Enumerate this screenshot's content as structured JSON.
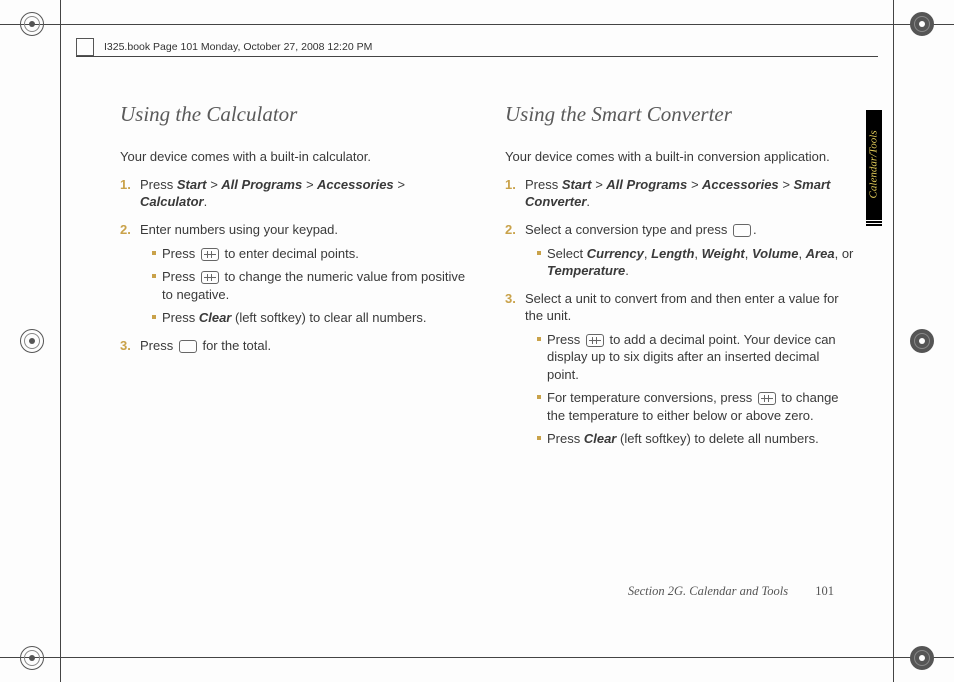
{
  "bookline": "I325.book  Page 101  Monday, October 27, 2008  12:20 PM",
  "tab_label": "Calendar/Tools",
  "footer_section": "Section 2G. Calendar and Tools",
  "footer_page": "101",
  "left": {
    "heading": "Using the Calculator",
    "intro": "Your device comes with a built-in calculator.",
    "step1_num": "1.",
    "step1_a": "Press ",
    "step1_b": "Start",
    "step1_c": " > ",
    "step1_d": "All Programs",
    "step1_e": " > ",
    "step1_f": "Accessories",
    "step1_g": " > ",
    "step1_h": "Calculator",
    "step1_i": ".",
    "step2_num": "2.",
    "step2_text": "Enter numbers using your keypad.",
    "step2_s1_a": "Press ",
    "step2_s1_b": " to enter decimal points.",
    "step2_s2_a": "Press ",
    "step2_s2_b": " to change the numeric value from positive to negative.",
    "step2_s3_a": "Press ",
    "step2_s3_b": "Clear",
    "step2_s3_c": " (left softkey) to clear all numbers.",
    "step3_num": "3.",
    "step3_a": "Press ",
    "step3_b": " for the total."
  },
  "right": {
    "heading": "Using the Smart Converter",
    "intro": "Your device comes with a built-in conversion application.",
    "step1_num": "1.",
    "step1_a": "Press ",
    "step1_b": "Start",
    "step1_c": " > ",
    "step1_d": "All Programs",
    "step1_e": " > ",
    "step1_f": "Accessories",
    "step1_g": " > ",
    "step1_h": "Smart Converter",
    "step1_i": ".",
    "step2_num": "2.",
    "step2_a": "Select a conversion type and press ",
    "step2_b": ".",
    "step2_s1_a": "Select ",
    "step2_s1_b": "Currency",
    "step2_s1_c": ", ",
    "step2_s1_d": "Length",
    "step2_s1_e": ", ",
    "step2_s1_f": "Weight",
    "step2_s1_g": ", ",
    "step2_s1_h": "Volume",
    "step2_s1_i": ", ",
    "step2_s1_j": "Area",
    "step2_s1_k": ", or ",
    "step2_s1_l": "Temperature",
    "step2_s1_m": ".",
    "step3_num": "3.",
    "step3_text": "Select a unit to convert from and then enter a value for the unit.",
    "step3_s1_a": "Press ",
    "step3_s1_b": " to add a decimal point. Your device can display up to six digits after an inserted decimal point.",
    "step3_s2_a": "For temperature conversions, press ",
    "step3_s2_b": " to change the temperature to either below or above zero.",
    "step3_s3_a": "Press ",
    "step3_s3_b": "Clear",
    "step3_s3_c": " (left softkey) to delete all numbers."
  }
}
